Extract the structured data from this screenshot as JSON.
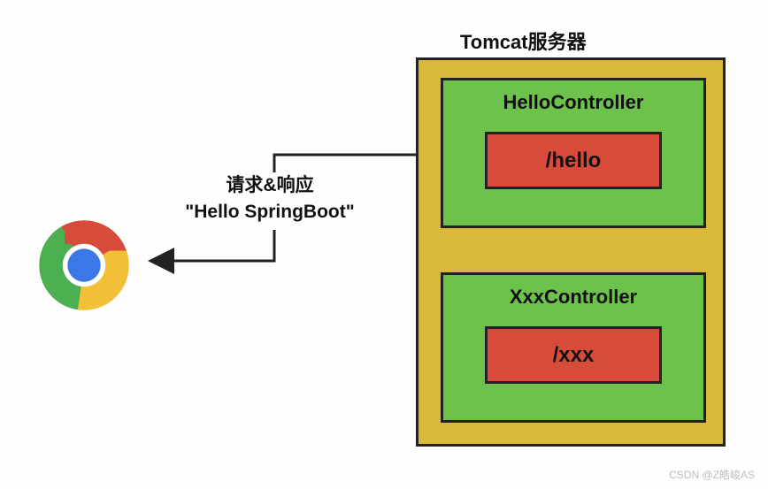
{
  "server": {
    "title": "Tomcat服务器",
    "controllers": [
      {
        "name": "HelloController",
        "route": "/hello"
      },
      {
        "name": "XxxController",
        "route": "/xxx"
      }
    ]
  },
  "arrow": {
    "label_line1": "请求&响应",
    "label_line2": "\"Hello SpringBoot\""
  },
  "client": {
    "icon_name": "chrome-browser-icon"
  },
  "watermark": "CSDN @Z皓峻AS"
}
